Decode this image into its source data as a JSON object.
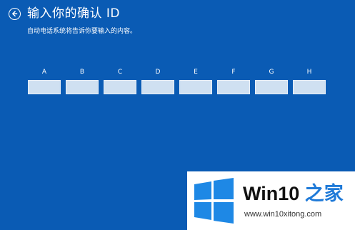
{
  "header": {
    "title": "输入你的确认 ID",
    "subtitle": "自动电话系统将告诉你要输入的内容。",
    "back_icon": "back-arrow-icon"
  },
  "confirmation_id": {
    "groups": [
      {
        "label": "A",
        "value": ""
      },
      {
        "label": "B",
        "value": ""
      },
      {
        "label": "C",
        "value": ""
      },
      {
        "label": "D",
        "value": ""
      },
      {
        "label": "E",
        "value": ""
      },
      {
        "label": "F",
        "value": ""
      },
      {
        "label": "G",
        "value": ""
      },
      {
        "label": "H",
        "value": ""
      }
    ]
  },
  "watermark": {
    "brand_main": "Win10",
    "brand_accent": "之家",
    "url": "www.win10xitong.com",
    "logo_icon": "windows-logo-icon"
  },
  "colors": {
    "background": "#0a5bb4",
    "input_fill": "#cfe0f1",
    "brand_accent": "#1f7ad8",
    "logo_blue": "#1e88e5"
  }
}
